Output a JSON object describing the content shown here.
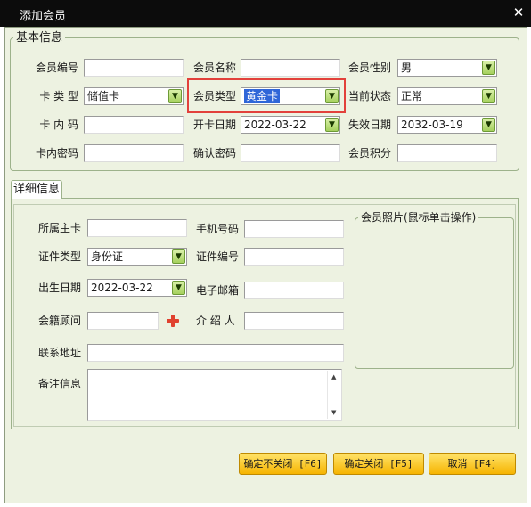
{
  "window": {
    "title": "添加会员",
    "close_glyph": "✕"
  },
  "basic": {
    "legend": "基本信息",
    "member_no": {
      "label": "会员编号",
      "value": ""
    },
    "member_name": {
      "label": "会员名称",
      "value": ""
    },
    "member_gender": {
      "label": "会员性别",
      "value": "男"
    },
    "card_type": {
      "label": "卡 类 型",
      "value": "储值卡"
    },
    "member_type": {
      "label": "会员类型",
      "value": "黄金卡"
    },
    "current_status": {
      "label": "当前状态",
      "value": "正常"
    },
    "card_inner_code": {
      "label": "卡 内 码",
      "value": ""
    },
    "open_date": {
      "label": "开卡日期",
      "value": "2022-03-22"
    },
    "expire_date": {
      "label": "失效日期",
      "value": "2032-03-19"
    },
    "card_password": {
      "label": "卡内密码",
      "value": ""
    },
    "confirm_password": {
      "label": "确认密码",
      "value": ""
    },
    "member_points": {
      "label": "会员积分",
      "value": ""
    }
  },
  "detail": {
    "tab_label": "详细信息",
    "main_card": {
      "label": "所属主卡",
      "value": ""
    },
    "phone": {
      "label": "手机号码",
      "value": ""
    },
    "id_type": {
      "label": "证件类型",
      "value": "身份证"
    },
    "id_number": {
      "label": "证件编号",
      "value": ""
    },
    "birth_date": {
      "label": "出生日期",
      "value": "2022-03-22"
    },
    "email": {
      "label": "电子邮箱",
      "value": ""
    },
    "advisor": {
      "label": "会籍顾问",
      "value": ""
    },
    "referrer": {
      "label": "介 绍 人",
      "value": ""
    },
    "address": {
      "label": "联系地址",
      "value": ""
    },
    "notes": {
      "label": "备注信息",
      "value": ""
    },
    "photo_legend": "会员照片(鼠标单击操作)"
  },
  "buttons": {
    "confirm_keep": "确定不关闭 [F6]",
    "confirm_close": "确定关闭 [F5]",
    "cancel": "取消 [F4]"
  },
  "icons": {
    "dropdown": "chevron-down-icon",
    "add": "plus-icon",
    "close": "close-icon"
  },
  "colors": {
    "title_bar": "#0c0c0c",
    "panel_bg": "#edf2e1",
    "button": "#f6b400",
    "dropdown_arrow": "#a5d05d",
    "highlight_box": "#e2413b",
    "selection": "#2f66d8",
    "add_icon": "#e0422f"
  }
}
